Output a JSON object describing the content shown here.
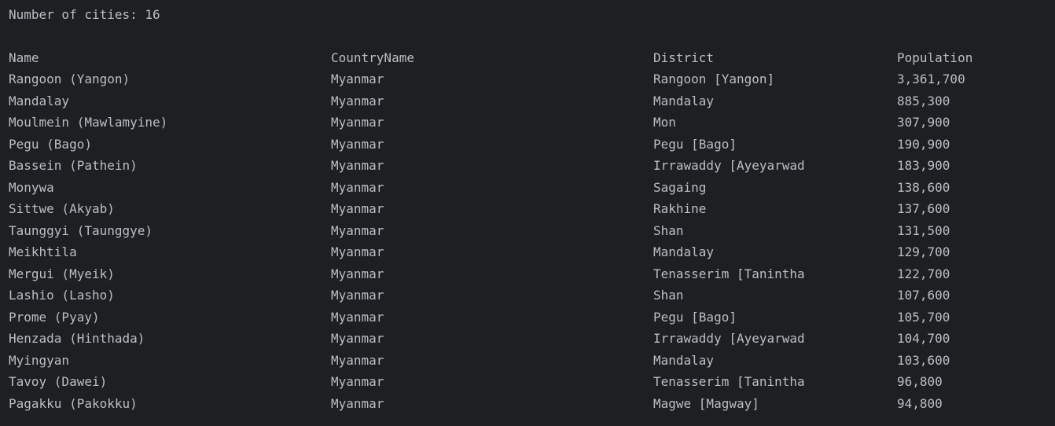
{
  "console": {
    "summary": "Number of cities: 16",
    "headers": {
      "name": "Name",
      "country": "CountryName",
      "district": "District",
      "population": "Population"
    },
    "rows": [
      {
        "name": "Rangoon (Yangon)",
        "country": "Myanmar",
        "district": "Rangoon [Yangon]",
        "population": "3,361,700"
      },
      {
        "name": "Mandalay",
        "country": "Myanmar",
        "district": "Mandalay",
        "population": "885,300"
      },
      {
        "name": "Moulmein (Mawlamyine)",
        "country": "Myanmar",
        "district": "Mon",
        "population": "307,900"
      },
      {
        "name": "Pegu (Bago)",
        "country": "Myanmar",
        "district": "Pegu [Bago]",
        "population": "190,900"
      },
      {
        "name": "Bassein (Pathein)",
        "country": "Myanmar",
        "district": "Irrawaddy [Ayeyarwad",
        "population": "183,900"
      },
      {
        "name": "Monywa",
        "country": "Myanmar",
        "district": "Sagaing",
        "population": "138,600"
      },
      {
        "name": "Sittwe (Akyab)",
        "country": "Myanmar",
        "district": "Rakhine",
        "population": "137,600"
      },
      {
        "name": "Taunggyi (Taunggye)",
        "country": "Myanmar",
        "district": "Shan",
        "population": "131,500"
      },
      {
        "name": "Meikhtila",
        "country": "Myanmar",
        "district": "Mandalay",
        "population": "129,700"
      },
      {
        "name": "Mergui (Myeik)",
        "country": "Myanmar",
        "district": "Tenasserim [Tanintha",
        "population": "122,700"
      },
      {
        "name": "Lashio (Lasho)",
        "country": "Myanmar",
        "district": "Shan",
        "population": "107,600"
      },
      {
        "name": "Prome (Pyay)",
        "country": "Myanmar",
        "district": "Pegu [Bago]",
        "population": "105,700"
      },
      {
        "name": "Henzada (Hinthada)",
        "country": "Myanmar",
        "district": "Irrawaddy [Ayeyarwad",
        "population": "104,700"
      },
      {
        "name": "Myingyan",
        "country": "Myanmar",
        "district": "Mandalay",
        "population": "103,600"
      },
      {
        "name": "Tavoy (Dawei)",
        "country": "Myanmar",
        "district": "Tenasserim [Tanintha",
        "population": "96,800"
      },
      {
        "name": "Pagakku (Pakokku)",
        "country": "Myanmar",
        "district": "Magwe [Magway]",
        "population": "94,800"
      }
    ]
  },
  "colors": {
    "background": "#1e1f22",
    "text": "#bcbec4"
  }
}
